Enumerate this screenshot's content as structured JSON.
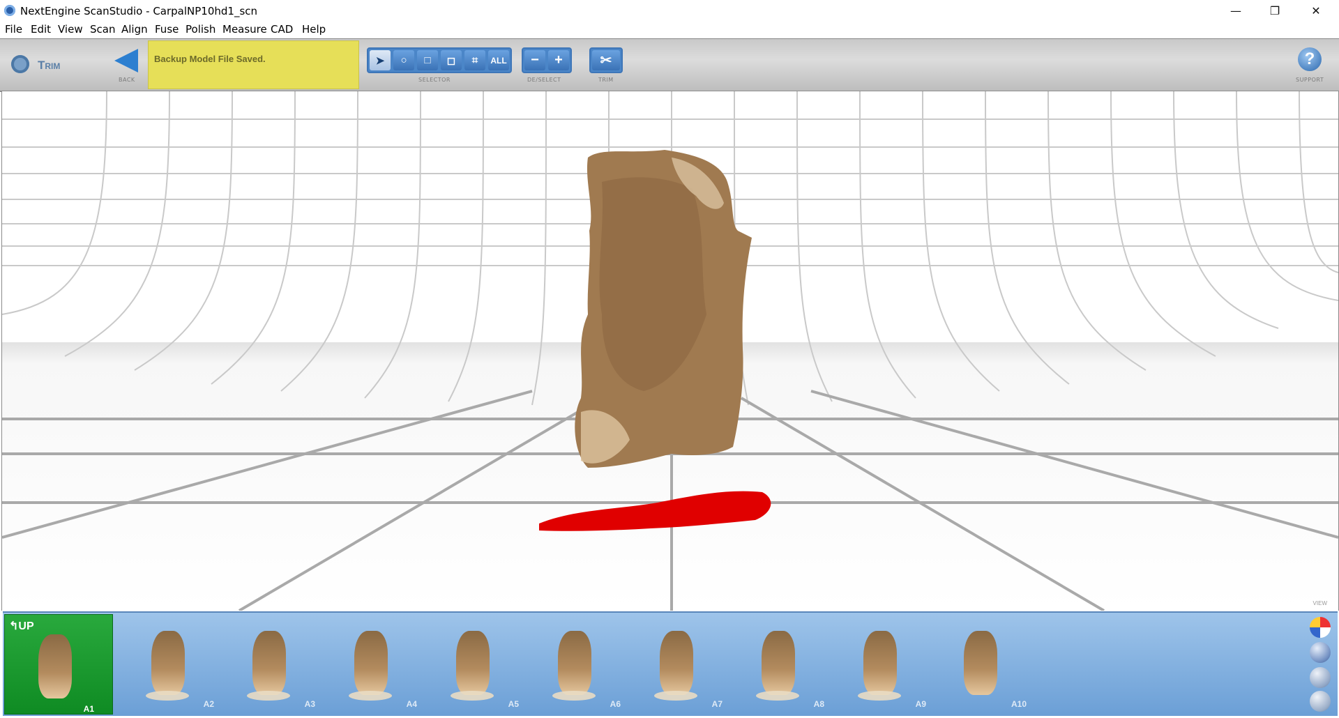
{
  "window": {
    "title": "NextEngine ScanStudio - CarpalNP10hd1_scn",
    "minimize": "—",
    "restore": "❐",
    "close": "✕"
  },
  "menu": [
    "File",
    "Edit",
    "View",
    "Scan",
    "Align",
    "Fuse",
    "Polish",
    "Measure",
    "CAD",
    "Help"
  ],
  "toolbar": {
    "mode": "Trim",
    "back_label": "Back",
    "status": "Backup Model File Saved.",
    "selector_label": "Selector",
    "selector_buttons": [
      "➤",
      "○",
      "□",
      "◻",
      "⌗",
      "ALL"
    ],
    "deselect_label": "De/Select",
    "deselect_buttons": [
      "−",
      "+"
    ],
    "trim_label": "Trim",
    "trim_icon": "✂",
    "support_label": "Support",
    "support_icon": "?"
  },
  "viewport": {
    "view_label": "View"
  },
  "strip": {
    "up_label": "UP",
    "up_arrow": "↰",
    "items": [
      "A1",
      "A2",
      "A3",
      "A4",
      "A5",
      "A6",
      "A7",
      "A8",
      "A9",
      "A10"
    ]
  },
  "colors": {
    "status_bg": "#e6df58",
    "up_bg": "#1f9e35",
    "strip_bg": "#84b2e2",
    "model_red": "#e00000",
    "model_tan": "#a07a50"
  }
}
